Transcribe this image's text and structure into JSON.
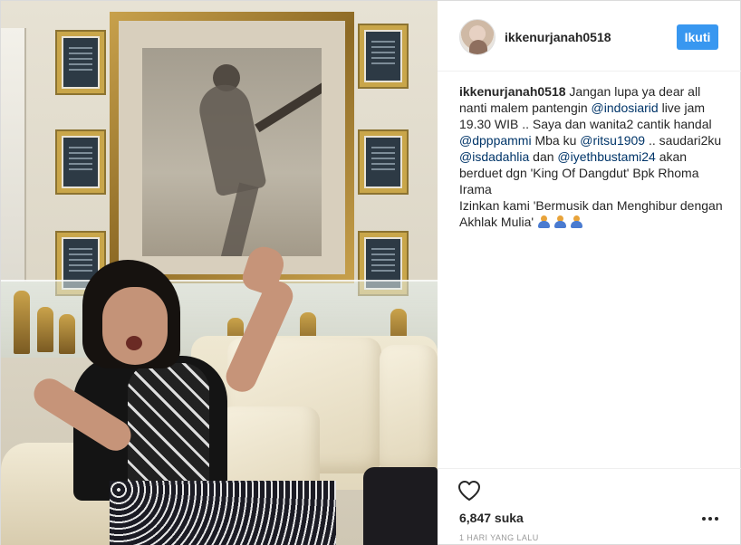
{
  "post": {
    "username": "ikkenurjanah0518",
    "follow_label": "Ikuti"
  },
  "caption": {
    "username": "ikkenurjanah0518",
    "text_1": "Jangan lupa ya dear all nanti malem pantengin",
    "mention_1": "@indosiarid",
    "text_2": "live jam 19.30 WIB .. Saya dan wanita2 cantik handal",
    "mention_2": "@dpppammi",
    "text_3": "Mba ku",
    "mention_3": "@ritsu1909",
    "text_4": ".. saudari2ku",
    "mention_4": "@isdadahlia",
    "text_5": "dan",
    "mention_5": "@iyethbustami24",
    "text_6": "akan berduet dgn 'King Of Dangdut' Bpk Rhoma Irama",
    "text_7": "Izinkan kami 'Bermusik dan Menghibur dengan Akhlak Mulia'"
  },
  "engagement": {
    "likes": "6,847 suka",
    "time_ago": "1 HARI YANG LALU"
  },
  "icons": {
    "like": "heart-icon",
    "more": "more-options-icon",
    "emoji": "people-emoji-icon"
  },
  "colors": {
    "follow_button": "#3897f0",
    "mention": "#003569",
    "text": "#262626",
    "muted": "#999999"
  }
}
